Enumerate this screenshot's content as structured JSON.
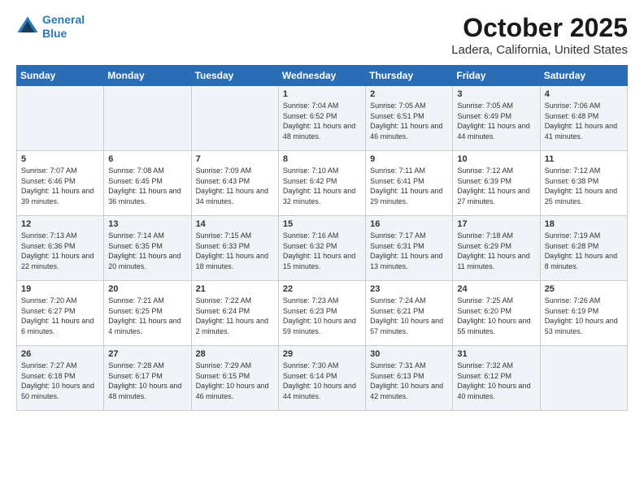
{
  "header": {
    "logo_line1": "General",
    "logo_line2": "Blue",
    "title": "October 2025",
    "subtitle": "Ladera, California, United States"
  },
  "days_of_week": [
    "Sunday",
    "Monday",
    "Tuesday",
    "Wednesday",
    "Thursday",
    "Friday",
    "Saturday"
  ],
  "weeks": [
    [
      {
        "day": "",
        "info": ""
      },
      {
        "day": "",
        "info": ""
      },
      {
        "day": "",
        "info": ""
      },
      {
        "day": "1",
        "info": "Sunrise: 7:04 AM\nSunset: 6:52 PM\nDaylight: 11 hours\nand 48 minutes."
      },
      {
        "day": "2",
        "info": "Sunrise: 7:05 AM\nSunset: 6:51 PM\nDaylight: 11 hours\nand 46 minutes."
      },
      {
        "day": "3",
        "info": "Sunrise: 7:05 AM\nSunset: 6:49 PM\nDaylight: 11 hours\nand 44 minutes."
      },
      {
        "day": "4",
        "info": "Sunrise: 7:06 AM\nSunset: 6:48 PM\nDaylight: 11 hours\nand 41 minutes."
      }
    ],
    [
      {
        "day": "5",
        "info": "Sunrise: 7:07 AM\nSunset: 6:46 PM\nDaylight: 11 hours\nand 39 minutes."
      },
      {
        "day": "6",
        "info": "Sunrise: 7:08 AM\nSunset: 6:45 PM\nDaylight: 11 hours\nand 36 minutes."
      },
      {
        "day": "7",
        "info": "Sunrise: 7:09 AM\nSunset: 6:43 PM\nDaylight: 11 hours\nand 34 minutes."
      },
      {
        "day": "8",
        "info": "Sunrise: 7:10 AM\nSunset: 6:42 PM\nDaylight: 11 hours\nand 32 minutes."
      },
      {
        "day": "9",
        "info": "Sunrise: 7:11 AM\nSunset: 6:41 PM\nDaylight: 11 hours\nand 29 minutes."
      },
      {
        "day": "10",
        "info": "Sunrise: 7:12 AM\nSunset: 6:39 PM\nDaylight: 11 hours\nand 27 minutes."
      },
      {
        "day": "11",
        "info": "Sunrise: 7:12 AM\nSunset: 6:38 PM\nDaylight: 11 hours\nand 25 minutes."
      }
    ],
    [
      {
        "day": "12",
        "info": "Sunrise: 7:13 AM\nSunset: 6:36 PM\nDaylight: 11 hours\nand 22 minutes."
      },
      {
        "day": "13",
        "info": "Sunrise: 7:14 AM\nSunset: 6:35 PM\nDaylight: 11 hours\nand 20 minutes."
      },
      {
        "day": "14",
        "info": "Sunrise: 7:15 AM\nSunset: 6:33 PM\nDaylight: 11 hours\nand 18 minutes."
      },
      {
        "day": "15",
        "info": "Sunrise: 7:16 AM\nSunset: 6:32 PM\nDaylight: 11 hours\nand 15 minutes."
      },
      {
        "day": "16",
        "info": "Sunrise: 7:17 AM\nSunset: 6:31 PM\nDaylight: 11 hours\nand 13 minutes."
      },
      {
        "day": "17",
        "info": "Sunrise: 7:18 AM\nSunset: 6:29 PM\nDaylight: 11 hours\nand 11 minutes."
      },
      {
        "day": "18",
        "info": "Sunrise: 7:19 AM\nSunset: 6:28 PM\nDaylight: 11 hours\nand 8 minutes."
      }
    ],
    [
      {
        "day": "19",
        "info": "Sunrise: 7:20 AM\nSunset: 6:27 PM\nDaylight: 11 hours\nand 6 minutes."
      },
      {
        "day": "20",
        "info": "Sunrise: 7:21 AM\nSunset: 6:25 PM\nDaylight: 11 hours\nand 4 minutes."
      },
      {
        "day": "21",
        "info": "Sunrise: 7:22 AM\nSunset: 6:24 PM\nDaylight: 11 hours\nand 2 minutes."
      },
      {
        "day": "22",
        "info": "Sunrise: 7:23 AM\nSunset: 6:23 PM\nDaylight: 10 hours\nand 59 minutes."
      },
      {
        "day": "23",
        "info": "Sunrise: 7:24 AM\nSunset: 6:21 PM\nDaylight: 10 hours\nand 57 minutes."
      },
      {
        "day": "24",
        "info": "Sunrise: 7:25 AM\nSunset: 6:20 PM\nDaylight: 10 hours\nand 55 minutes."
      },
      {
        "day": "25",
        "info": "Sunrise: 7:26 AM\nSunset: 6:19 PM\nDaylight: 10 hours\nand 53 minutes."
      }
    ],
    [
      {
        "day": "26",
        "info": "Sunrise: 7:27 AM\nSunset: 6:18 PM\nDaylight: 10 hours\nand 50 minutes."
      },
      {
        "day": "27",
        "info": "Sunrise: 7:28 AM\nSunset: 6:17 PM\nDaylight: 10 hours\nand 48 minutes."
      },
      {
        "day": "28",
        "info": "Sunrise: 7:29 AM\nSunset: 6:15 PM\nDaylight: 10 hours\nand 46 minutes."
      },
      {
        "day": "29",
        "info": "Sunrise: 7:30 AM\nSunset: 6:14 PM\nDaylight: 10 hours\nand 44 minutes."
      },
      {
        "day": "30",
        "info": "Sunrise: 7:31 AM\nSunset: 6:13 PM\nDaylight: 10 hours\nand 42 minutes."
      },
      {
        "day": "31",
        "info": "Sunrise: 7:32 AM\nSunset: 6:12 PM\nDaylight: 10 hours\nand 40 minutes."
      },
      {
        "day": "",
        "info": ""
      }
    ]
  ]
}
